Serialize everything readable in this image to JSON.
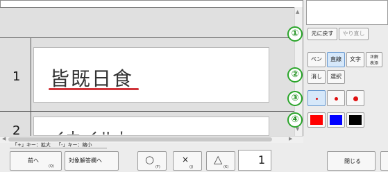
{
  "viewer": {
    "row1_number": "1",
    "row1_answer": "皆既日食",
    "row2_number": "2",
    "row2_answer_partial": "イカイルト"
  },
  "markers": {
    "m1": "①",
    "m2": "②",
    "m3": "③",
    "m4": "④"
  },
  "toolbar": {
    "undo_label": "元に戻す",
    "redo_label": "やり直し",
    "pen_label": "ペン",
    "line_label": "直線",
    "text_label": "文字",
    "correct_label_1": "正解",
    "correct_label_2": "表添",
    "erase_label": "消し",
    "select_label": "選択",
    "pen_sizes": [
      "small",
      "medium",
      "large"
    ],
    "selected_size": "small",
    "selected_tool": "直線",
    "colors": [
      "#ff0000",
      "#0000ff",
      "#000000"
    ],
    "pen_dot_color": "#e01010"
  },
  "hints": {
    "zoom_in": "「+」キー：拡大",
    "zoom_out": "「-」キー：縮小"
  },
  "bottom": {
    "prev_label": "前へ",
    "prev_key": "(Q)",
    "target_label": "対象解答欄へ",
    "circle_symbol": "○",
    "circle_key": "(F)",
    "cross_symbol": "×",
    "cross_key": "(J)",
    "triangle_symbol": "△",
    "triangle_key": "(K)",
    "page_value": "1",
    "close_label": "閉じる"
  },
  "colors": {
    "accent_green": "#2aa52a",
    "underline_red": "#d0343a",
    "selected_blue": "#d6e8fa"
  }
}
